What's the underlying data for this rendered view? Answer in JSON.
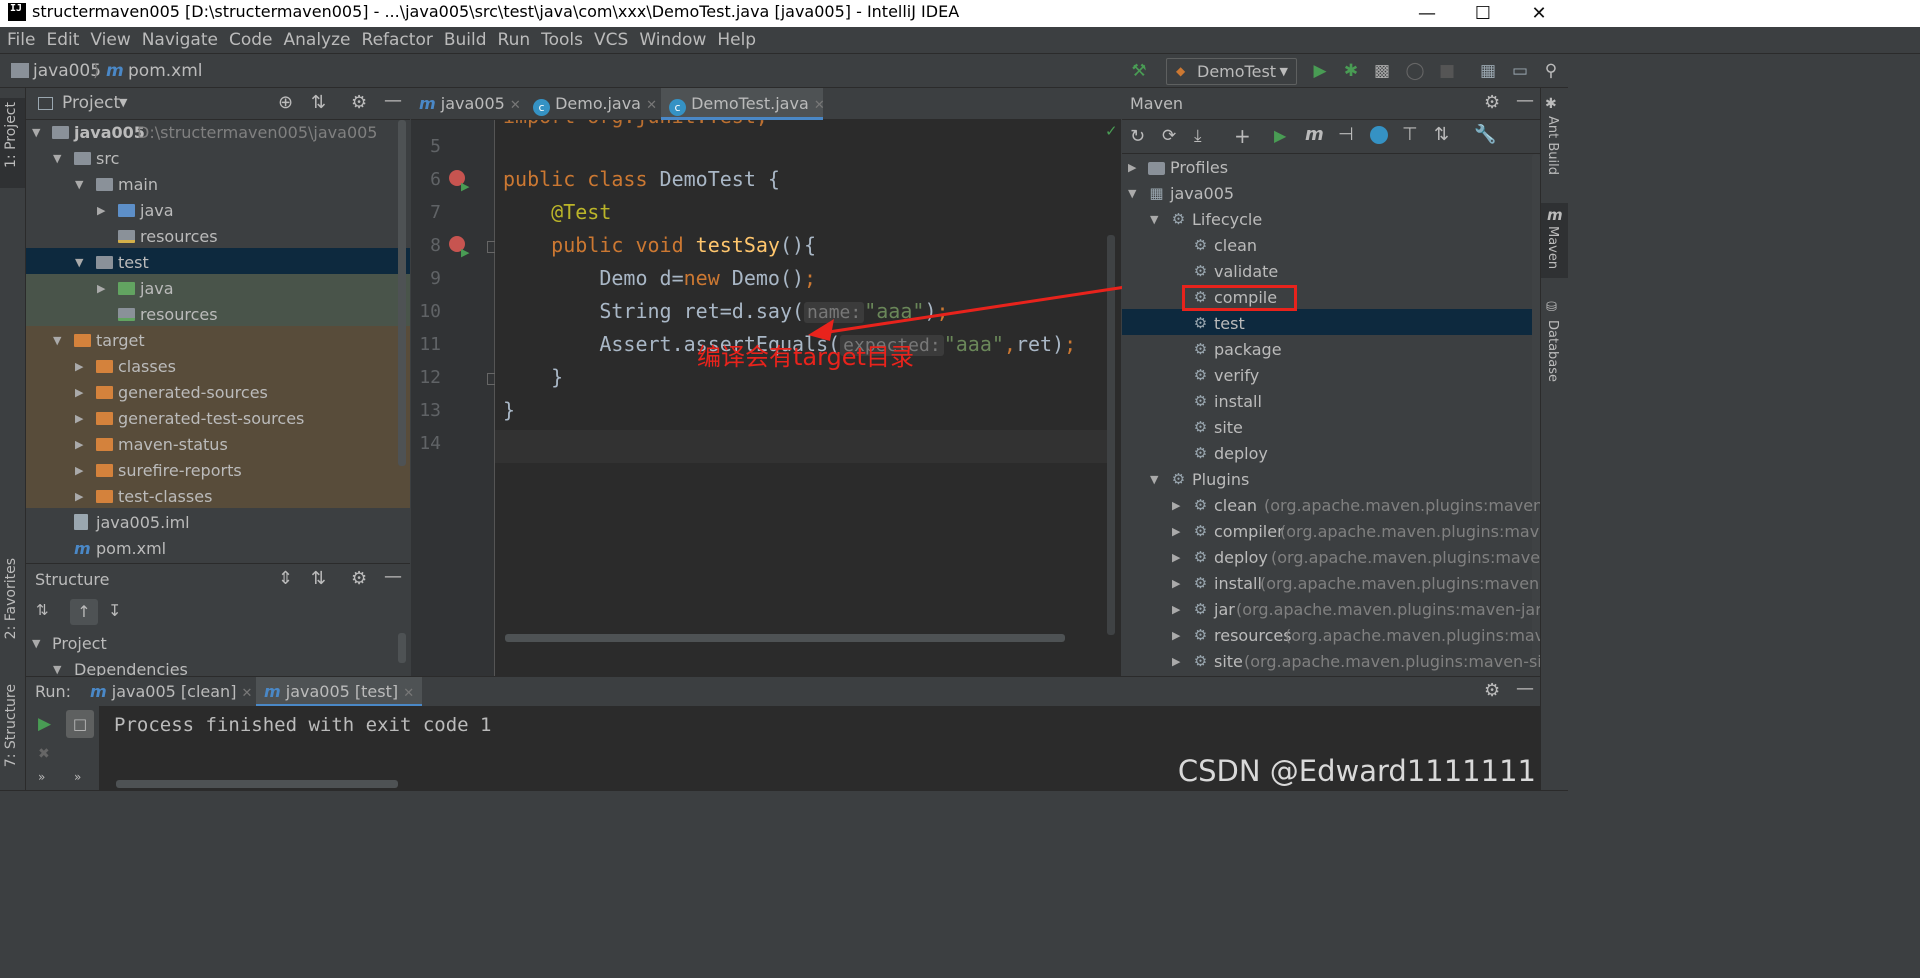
{
  "window": {
    "title": "structermaven005 [D:\\structermaven005] - ...\\java005\\src\\test\\java\\com\\xxx\\DemoTest.java [java005] - IntelliJ IDEA",
    "logo_text": "IJ",
    "min_icon": "minimize-icon",
    "max_icon": "maximize-icon",
    "close_icon": "close-icon"
  },
  "menu": [
    "File",
    "Edit",
    "View",
    "Navigate",
    "Code",
    "Analyze",
    "Refactor",
    "Build",
    "Run",
    "Tools",
    "VCS",
    "Window",
    "Help"
  ],
  "breadcrumb": {
    "project": "java005",
    "file": "pom.xml",
    "file_icon": "m"
  },
  "toolbar": {
    "run_config": "DemoTest"
  },
  "left_stripe": {
    "project": "1: Project",
    "favorites": "2: Favorites",
    "structure": "7: Structure"
  },
  "project_panel": {
    "title": "Project",
    "tree": [
      {
        "name": "java005",
        "path": "D:\\structermaven005\\java005",
        "depth": 0,
        "expanded": true,
        "icon": "module-folder"
      },
      {
        "name": "src",
        "depth": 1,
        "expanded": true,
        "icon": "folder"
      },
      {
        "name": "main",
        "depth": 2,
        "expanded": true,
        "icon": "folder"
      },
      {
        "name": "java",
        "depth": 3,
        "expanded": false,
        "icon": "source-folder"
      },
      {
        "name": "resources",
        "depth": 3,
        "icon": "resources-folder"
      },
      {
        "name": "test",
        "depth": 2,
        "expanded": true,
        "icon": "folder",
        "selected": true
      },
      {
        "name": "java",
        "depth": 3,
        "expanded": false,
        "icon": "test-source-folder"
      },
      {
        "name": "resources",
        "depth": 3,
        "icon": "test-resources-folder"
      },
      {
        "name": "target",
        "depth": 1,
        "expanded": true,
        "icon": "excluded-folder"
      },
      {
        "name": "classes",
        "depth": 2,
        "expanded": false,
        "icon": "excluded-folder"
      },
      {
        "name": "generated-sources",
        "depth": 2,
        "expanded": false,
        "icon": "excluded-folder"
      },
      {
        "name": "generated-test-sources",
        "depth": 2,
        "expanded": false,
        "icon": "excluded-folder"
      },
      {
        "name": "maven-status",
        "depth": 2,
        "expanded": false,
        "icon": "excluded-folder"
      },
      {
        "name": "surefire-reports",
        "depth": 2,
        "expanded": false,
        "icon": "excluded-folder"
      },
      {
        "name": "test-classes",
        "depth": 2,
        "expanded": false,
        "icon": "excluded-folder"
      },
      {
        "name": "java005.iml",
        "depth": 1,
        "icon": "iml-file"
      },
      {
        "name": "pom.xml",
        "depth": 1,
        "icon": "maven-file"
      }
    ]
  },
  "structure_panel": {
    "title": "Structure",
    "tree": [
      {
        "name": "Project",
        "depth": 0
      },
      {
        "name": "Dependencies",
        "depth": 1
      }
    ]
  },
  "editor": {
    "tabs": [
      {
        "label": "java005",
        "icon": "m",
        "active": false
      },
      {
        "label": "Demo.java",
        "icon": "c",
        "active": false
      },
      {
        "label": "DemoTest.java",
        "icon": "c",
        "active": true
      }
    ],
    "lines": [
      {
        "n": "",
        "text": "import org.junit.Test;"
      },
      {
        "n": "5",
        "text": ""
      },
      {
        "n": "6",
        "text": "public class DemoTest {"
      },
      {
        "n": "7",
        "text": "    @Test"
      },
      {
        "n": "8",
        "text": "    public void testSay(){"
      },
      {
        "n": "9",
        "text": "        Demo d=new Demo();"
      },
      {
        "n": "10",
        "text": "        String ret=d.say( name: \"aaa\");"
      },
      {
        "n": "11",
        "text": "        Assert.assertEquals( expected: \"aaa\",ret);"
      },
      {
        "n": "12",
        "text": "    }"
      },
      {
        "n": "13",
        "text": "}"
      },
      {
        "n": "14",
        "text": ""
      }
    ],
    "annotation": "编译会有target目录"
  },
  "maven_panel": {
    "title": "Maven",
    "tree": [
      {
        "name": "Profiles",
        "depth": 0,
        "expanded": false
      },
      {
        "name": "java005",
        "depth": 0,
        "expanded": true
      },
      {
        "name": "Lifecycle",
        "depth": 1,
        "expanded": true
      },
      {
        "name": "clean",
        "depth": 2
      },
      {
        "name": "validate",
        "depth": 2
      },
      {
        "name": "compile",
        "depth": 2,
        "boxed": true
      },
      {
        "name": "test",
        "depth": 2,
        "selected": true
      },
      {
        "name": "package",
        "depth": 2
      },
      {
        "name": "verify",
        "depth": 2
      },
      {
        "name": "install",
        "depth": 2
      },
      {
        "name": "site",
        "depth": 2
      },
      {
        "name": "deploy",
        "depth": 2
      },
      {
        "name": "Plugins",
        "depth": 1,
        "expanded": true
      },
      {
        "name": "clean",
        "detail": "(org.apache.maven.plugins:maven-clean-",
        "depth": 2
      },
      {
        "name": "compiler",
        "detail": "(org.apache.maven.plugins:maven-co",
        "depth": 2
      },
      {
        "name": "deploy",
        "detail": "(org.apache.maven.plugins:maven-depl",
        "depth": 2
      },
      {
        "name": "install",
        "detail": "(org.apache.maven.plugins:maven-instal",
        "depth": 2
      },
      {
        "name": "jar",
        "detail": "(org.apache.maven.plugins:maven-jar-plugi",
        "depth": 2
      },
      {
        "name": "resources",
        "detail": "(org.apache.maven.plugins:maven-re",
        "depth": 2
      },
      {
        "name": "site",
        "detail": "(org.apache.maven.plugins:maven-site-plu",
        "depth": 2
      }
    ]
  },
  "right_stripe": {
    "ant": "Ant Build",
    "maven": "Maven",
    "database": "Database"
  },
  "run_panel": {
    "label": "Run:",
    "tabs": [
      {
        "label": "java005 [clean]"
      },
      {
        "label": "java005 [test]"
      }
    ],
    "output": "Process finished with exit code 1"
  },
  "watermark": "CSDN @Edward1111111",
  "colors": {
    "accent": "#4a88c7",
    "annotation_red": "#e8231c",
    "selection": "#0d293e"
  }
}
